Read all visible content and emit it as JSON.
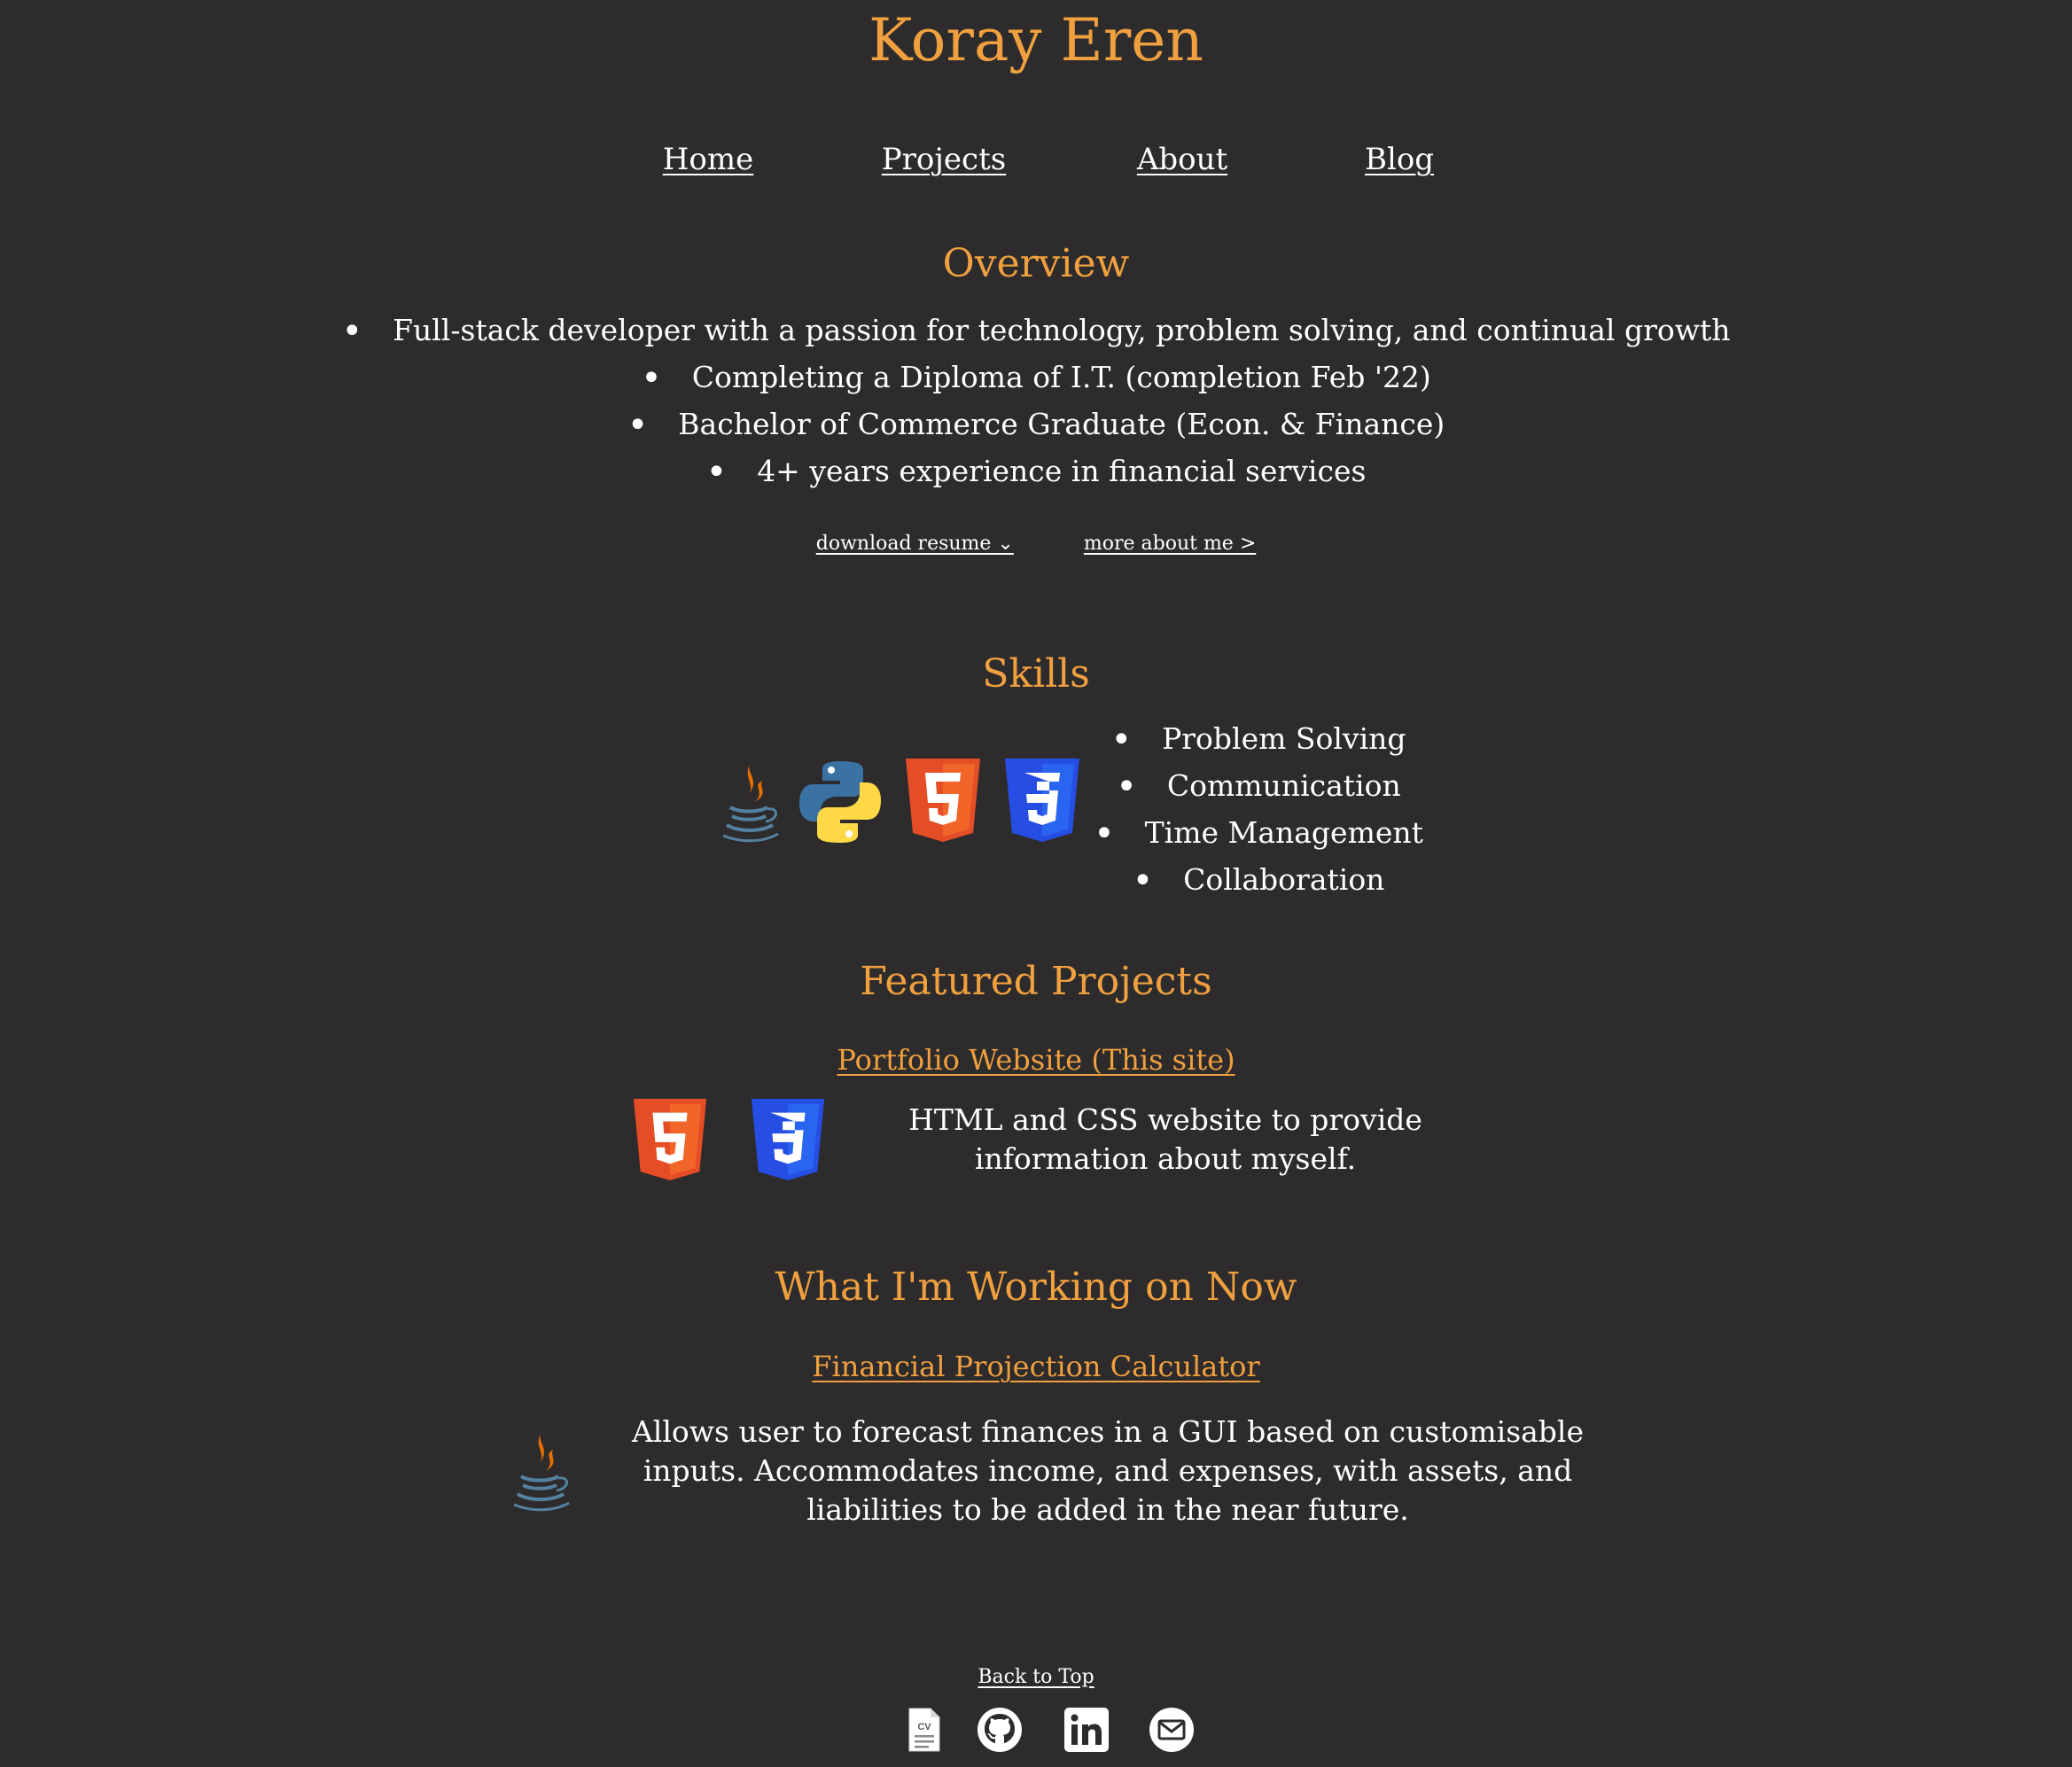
{
  "header": {
    "title": "Koray Eren"
  },
  "nav": {
    "items": [
      "Home",
      "Projects",
      "About",
      "Blog"
    ]
  },
  "overview": {
    "heading": "Overview",
    "bullets": [
      "Full-stack developer with a passion for technology, problem solving, and continual growth",
      "Completing a Diploma of I.T. (completion Feb '22)",
      "Bachelor of Commerce Graduate (Econ. & Finance)",
      "4+ years experience in financial services"
    ],
    "download_link": "download resume ⌄",
    "more_link": "more about me >"
  },
  "skills": {
    "heading": "Skills",
    "icons": [
      "java-icon",
      "python-icon",
      "html5-icon",
      "css3-icon"
    ],
    "items": [
      "Problem Solving",
      "Communication",
      "Time Management",
      "Collaboration"
    ]
  },
  "featured": {
    "heading": "Featured Projects",
    "project_title": "Portfolio Website (This site)",
    "icons": [
      "html5-icon",
      "css3-icon"
    ],
    "description": "HTML and CSS website to provide information about myself."
  },
  "working_on": {
    "heading": "What I'm Working on Now",
    "project_title": "Financial Projection Calculator",
    "icons": [
      "java-icon"
    ],
    "description": "Allows user to forecast finances in a GUI based on customisable inputs. Accommodates income, and expenses, with assets, and liabilities to be added in the near future."
  },
  "footer": {
    "back_to_top": "Back to Top",
    "social_icons": [
      "cv-icon",
      "github-icon",
      "linkedin-icon",
      "email-icon"
    ],
    "cv_icon_text": "CV"
  },
  "colors": {
    "background": "#2d2b2c",
    "accent": "#f0a03f",
    "text": "#ffffff",
    "html5": "#e44d26",
    "css3": "#264de4",
    "python_blue": "#3b72a4",
    "python_yellow": "#ffd845",
    "java_orange": "#e76f00",
    "java_blue": "#5382a1"
  }
}
